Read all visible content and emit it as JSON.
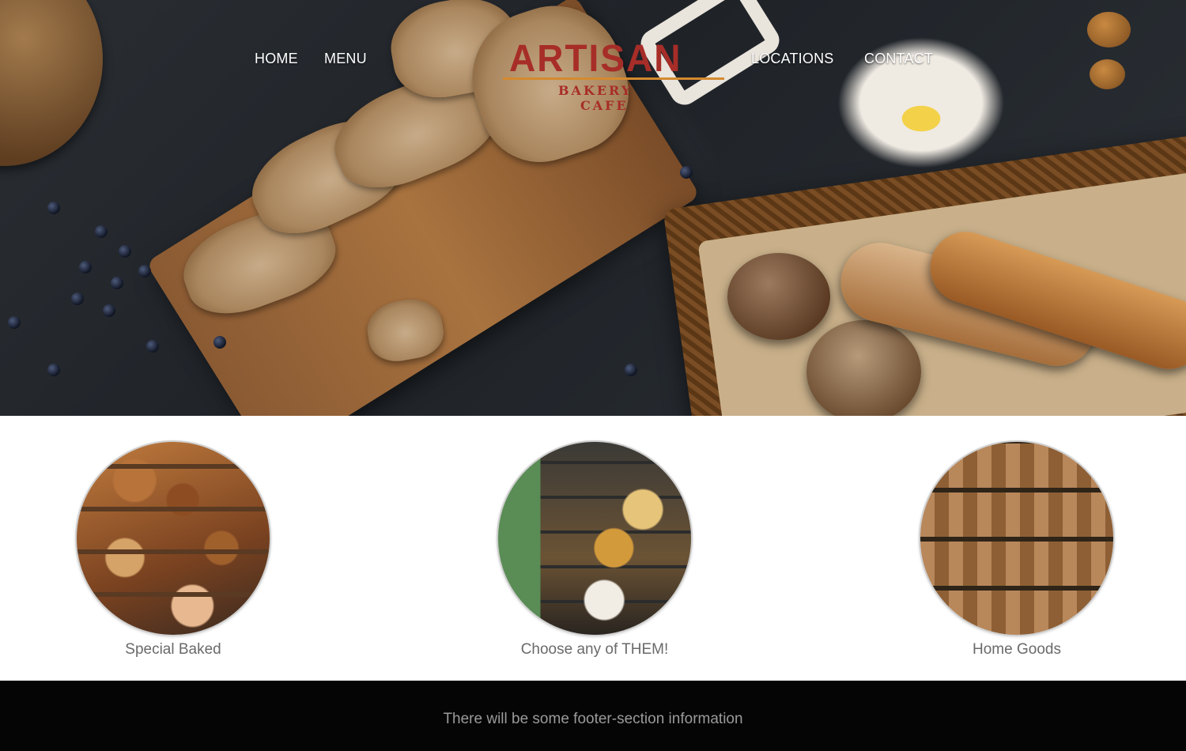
{
  "header": {
    "nav_left": [
      "HOME",
      "MENU"
    ],
    "nav_right": [
      "LOCATIONS",
      "CONTACT"
    ],
    "logo": {
      "title": "ARTISAN",
      "subtitle_line1": "BAKERY",
      "subtitle_line2": "CAFE",
      "color": "#a72d28",
      "accent": "#d48a2f"
    }
  },
  "features": [
    {
      "label": "Special Baked"
    },
    {
      "label": "Choose any of THEM!"
    },
    {
      "label": "Home Goods"
    }
  ],
  "footer": {
    "text": "There will be some footer-section information"
  },
  "colors": {
    "footer_bg": "#050505",
    "footer_text": "#9a9a9a",
    "label_text": "#6a6a6a"
  }
}
